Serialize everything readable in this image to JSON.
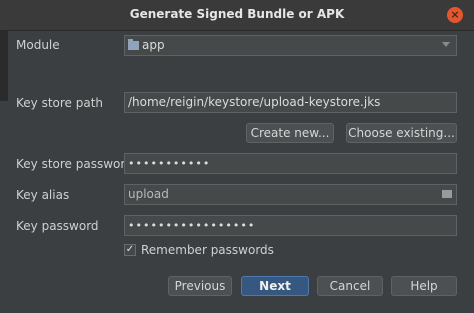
{
  "window": {
    "title": "Generate Signed Bundle or APK",
    "close_glyph": "×"
  },
  "form": {
    "module_label": "Module",
    "module_value": "app",
    "key_store_path_label": "Key store path",
    "key_store_path_value": "/home/reigin/keystore/upload-keystore.jks",
    "create_new_label": "Create new...",
    "choose_existing_label": "Choose existing...",
    "key_store_password_label": "Key store password",
    "key_store_password_value": "•••••••••••",
    "key_alias_label": "Key alias",
    "key_alias_value": "upload",
    "key_password_label": "Key password",
    "key_password_value": "•••••••••••••••••",
    "remember_passwords_label": "Remember passwords",
    "remember_checked_glyph": "✓"
  },
  "footer": {
    "previous_label": "Previous",
    "next_label": "Next",
    "cancel_label": "Cancel",
    "help_label": "Help"
  },
  "colors": {
    "dialog_bg": "#3c3f41",
    "field_bg": "#45494a",
    "default_button": "#365880",
    "close_button": "#e4572e"
  }
}
